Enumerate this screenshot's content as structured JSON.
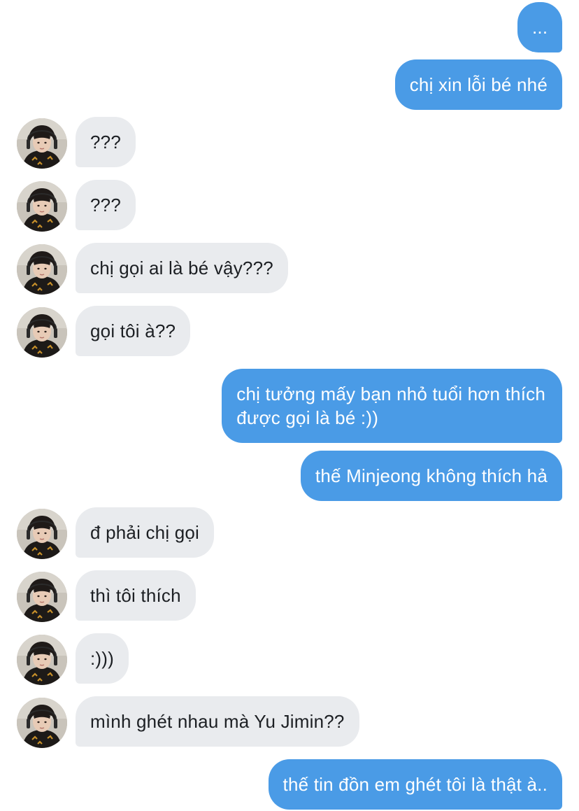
{
  "conversation": {
    "messages": [
      {
        "side": "sent",
        "text": "..."
      },
      {
        "side": "sent",
        "text": "chị xin lỗi bé nhé"
      },
      {
        "side": "received",
        "text": "???"
      },
      {
        "side": "received",
        "text": "???"
      },
      {
        "side": "received",
        "text": "chị gọi ai là bé vậy???"
      },
      {
        "side": "received",
        "text": "gọi tôi à??"
      },
      {
        "side": "sent",
        "text": "chị tưởng mấy bạn nhỏ tuổi hơn thích\nđược gọi là bé :))"
      },
      {
        "side": "sent",
        "text": "thế Minjeong không thích hả"
      },
      {
        "side": "received",
        "text": "đ phải chị gọi"
      },
      {
        "side": "received",
        "text": "thì tôi thích"
      },
      {
        "side": "received",
        "text": ":)))"
      },
      {
        "side": "received",
        "text": "mình ghét nhau mà Yu Jimin??"
      },
      {
        "side": "sent",
        "text": "thế tin đồn em ghét tôi là thật à.."
      }
    ]
  },
  "colors": {
    "sent_bubble": "#4a9be6",
    "received_bubble": "#e9ebee"
  },
  "icons": {
    "avatar": "contact-avatar-photo"
  }
}
